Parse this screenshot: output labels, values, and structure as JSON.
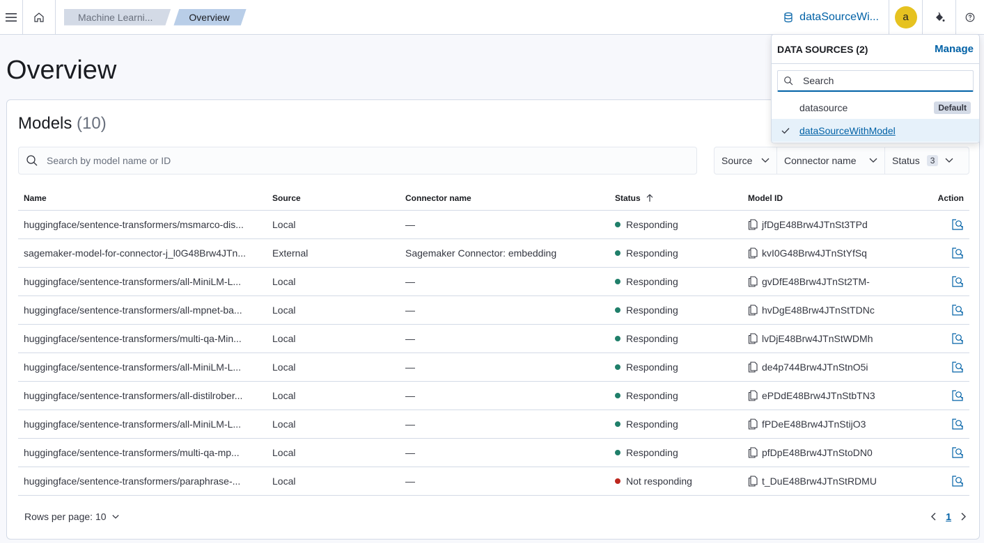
{
  "header": {
    "breadcrumbs": [
      "Machine Learni...",
      "Overview"
    ],
    "data_source_label": "dataSourceWi...",
    "avatar_initial": "a"
  },
  "page": {
    "title": "Overview"
  },
  "models": {
    "title": "Models",
    "count": "(10)",
    "search_placeholder": "Search by model name or ID",
    "filters": {
      "source": "Source",
      "connector": "Connector name",
      "status": "Status",
      "status_count": "3"
    },
    "columns": [
      "Name",
      "Source",
      "Connector name",
      "Status",
      "Model ID",
      "Action"
    ],
    "rows": [
      {
        "name": "huggingface/sentence-transformers/msmarco-dis...",
        "source": "Local",
        "connector": "—",
        "status": "Responding",
        "status_color": "#207f6a",
        "model_id": "jfDgE48Brw4JTnSt3TPd"
      },
      {
        "name": "sagemaker-model-for-connector-j_l0G48Brw4JTn...",
        "source": "External",
        "connector": "Sagemaker Connector: embedding",
        "status": "Responding",
        "status_color": "#207f6a",
        "model_id": "kvI0G48Brw4JTnStYfSq"
      },
      {
        "name": "huggingface/sentence-transformers/all-MiniLM-L...",
        "source": "Local",
        "connector": "—",
        "status": "Responding",
        "status_color": "#207f6a",
        "model_id": "gvDfE48Brw4JTnSt2TM-"
      },
      {
        "name": "huggingface/sentence-transformers/all-mpnet-ba...",
        "source": "Local",
        "connector": "—",
        "status": "Responding",
        "status_color": "#207f6a",
        "model_id": "hvDgE48Brw4JTnStTDNc"
      },
      {
        "name": "huggingface/sentence-transformers/multi-qa-Min...",
        "source": "Local",
        "connector": "—",
        "status": "Responding",
        "status_color": "#207f6a",
        "model_id": "lvDjE48Brw4JTnStWDMh"
      },
      {
        "name": "huggingface/sentence-transformers/all-MiniLM-L...",
        "source": "Local",
        "connector": "—",
        "status": "Responding",
        "status_color": "#207f6a",
        "model_id": "de4p744Brw4JTnStnO5i"
      },
      {
        "name": "huggingface/sentence-transformers/all-distilrober...",
        "source": "Local",
        "connector": "—",
        "status": "Responding",
        "status_color": "#207f6a",
        "model_id": "ePDdE48Brw4JTnStbTN3"
      },
      {
        "name": "huggingface/sentence-transformers/all-MiniLM-L...",
        "source": "Local",
        "connector": "—",
        "status": "Responding",
        "status_color": "#207f6a",
        "model_id": "fPDeE48Brw4JTnStijO3"
      },
      {
        "name": "huggingface/sentence-transformers/multi-qa-mp...",
        "source": "Local",
        "connector": "—",
        "status": "Responding",
        "status_color": "#207f6a",
        "model_id": "pfDpE48Brw4JTnStoDN0"
      },
      {
        "name": "huggingface/sentence-transformers/paraphrase-...",
        "source": "Local",
        "connector": "—",
        "status": "Not responding",
        "status_color": "#bd271e",
        "model_id": "t_DuE48Brw4JTnStRDMU"
      }
    ],
    "rows_per_page": "Rows per page: 10",
    "current_page": "1"
  },
  "popover": {
    "title": "DATA SOURCES (2)",
    "manage": "Manage",
    "search_placeholder": "Search",
    "items": [
      {
        "label": "datasource",
        "badge": "Default",
        "selected": false
      },
      {
        "label": "dataSourceWithModel",
        "badge": "",
        "selected": true
      }
    ]
  },
  "colors": {
    "accent": "#0061a6",
    "responding": "#207f6a",
    "not_responding": "#bd271e"
  }
}
